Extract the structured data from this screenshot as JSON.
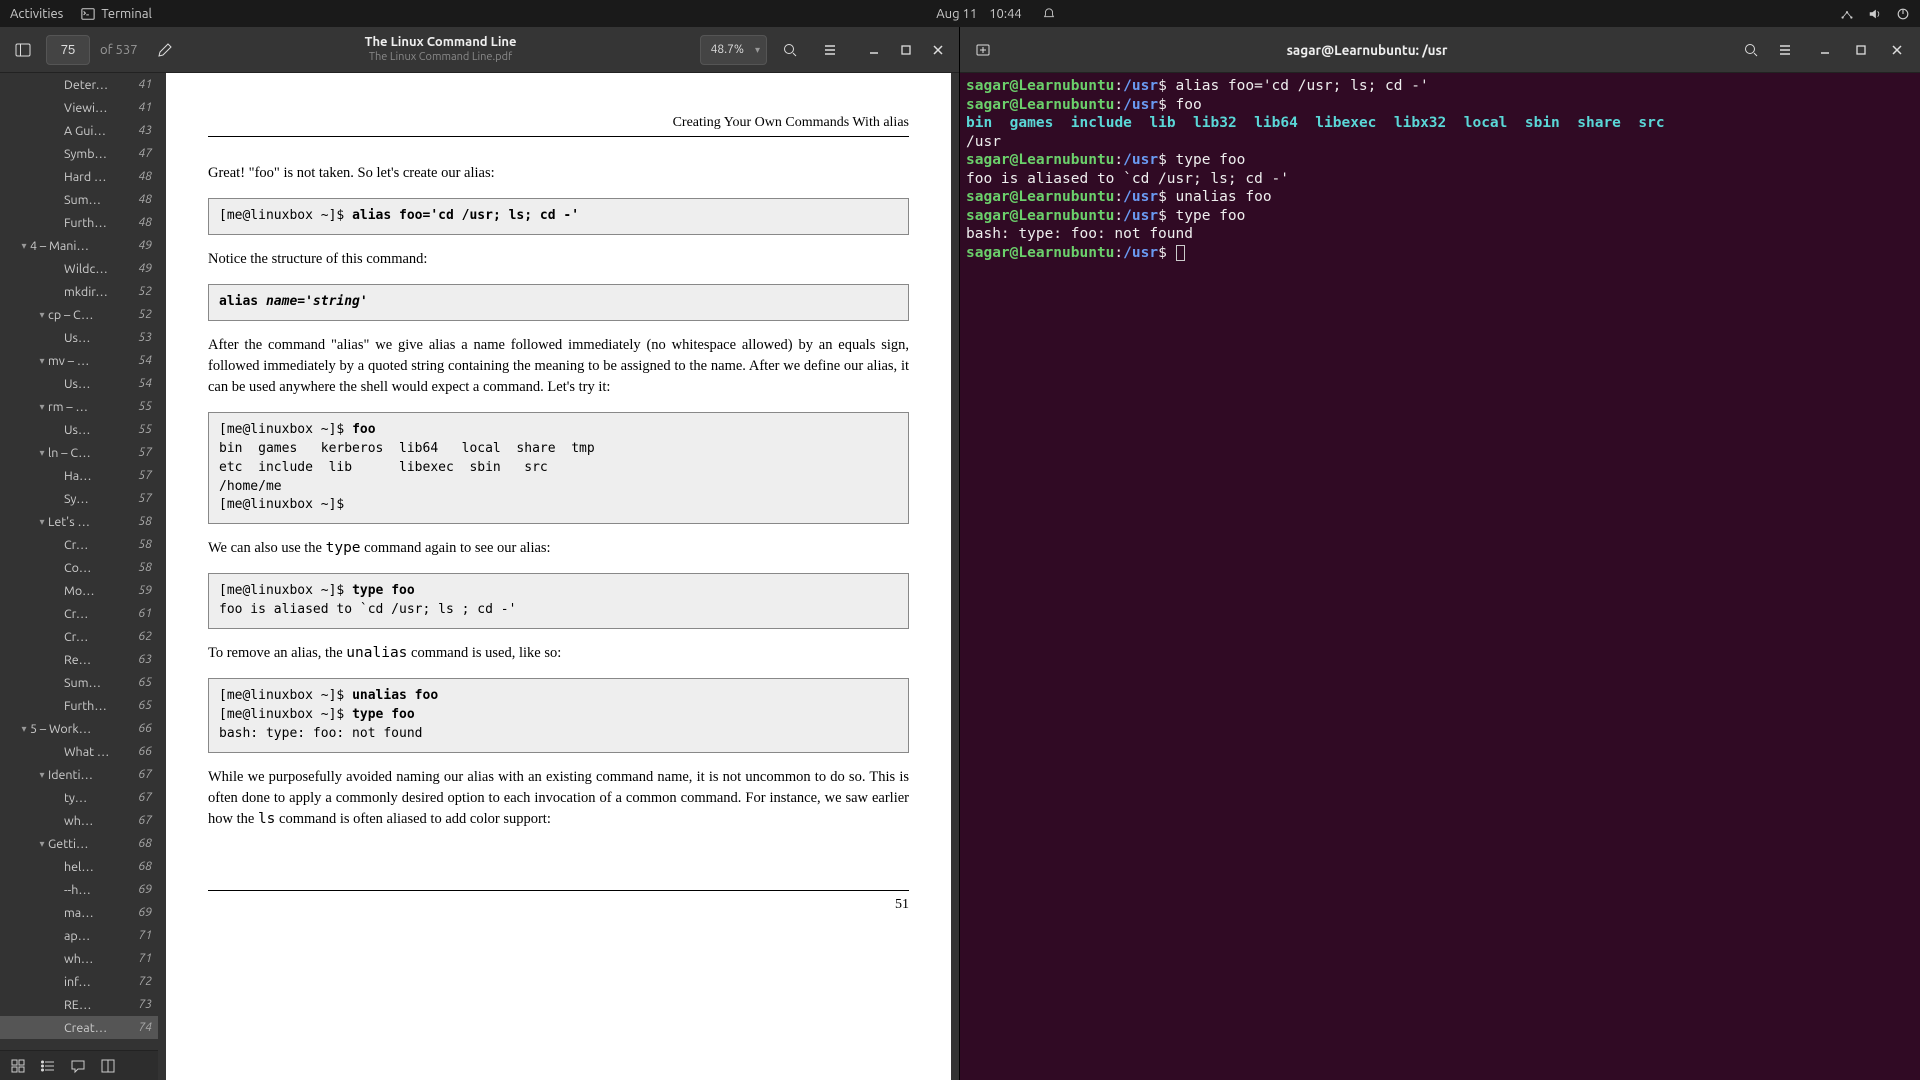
{
  "topbar": {
    "activities": "Activities",
    "app": "Terminal",
    "date": "Aug 11",
    "time": "10:44"
  },
  "pdf": {
    "page_input": "75",
    "page_of": "of 537",
    "title": "The Linux Command Line",
    "subtitle": "The Linux Command Line.pdf",
    "zoom": "48.7%",
    "chapter_header": "Creating Your Own Commands With alias",
    "para1": "Great! \"foo\" is not taken. So let's create our alias:",
    "code1_prompt": "[me@linuxbox ~]$ ",
    "code1_cmd": "alias foo='cd /usr; ls; cd -'",
    "para2": "Notice the structure of this command:",
    "code2_a": "alias ",
    "code2_b": "name='string'",
    "para3": "After the command \"alias\" we give alias a name followed immediately (no whitespace allowed) by an equals sign, followed immediately by a quoted string containing the meaning to be assigned to the name. After we define our alias, it can be used anywhere the shell would expect a command. Let's try it:",
    "code3_prompt": "[me@linuxbox ~]$ ",
    "code3_cmd": "foo",
    "code3_out": "bin  games   kerberos  lib64   local  share  tmp\netc  include  lib      libexec  sbin   src\n/home/me\n[me@linuxbox ~]$",
    "para4a": "We can also use the ",
    "para4_mono": "type",
    "para4b": " command again to see our alias:",
    "code4_prompt": "[me@linuxbox ~]$ ",
    "code4_cmd": "type foo",
    "code4_out": "foo is aliased to `cd /usr; ls ; cd -'",
    "para5a": "To remove an alias, the ",
    "para5_mono": "unalias",
    "para5b": " command is used, like so:",
    "code5_prompt1": "[me@linuxbox ~]$ ",
    "code5_cmd1": "unalias foo",
    "code5_prompt2": "[me@linuxbox ~]$ ",
    "code5_cmd2": "type foo",
    "code5_out": "bash: type: foo: not found",
    "para6a": "While we purposefully avoided naming our alias with an existing command name, it is not uncommon to do so. This is often done to apply a commonly desired option to each invocation of a common command. For instance, we saw earlier how the ",
    "para6_mono": "ls",
    "para6b": " command is often aliased to add color support:",
    "page_number": "51"
  },
  "outline": [
    {
      "indent": 3,
      "chev": "",
      "label": "Deter…",
      "page": "41",
      "sel": false
    },
    {
      "indent": 3,
      "chev": "",
      "label": "Viewi…",
      "page": "41",
      "sel": false
    },
    {
      "indent": 3,
      "chev": "",
      "label": "A Gui…",
      "page": "43",
      "sel": false
    },
    {
      "indent": 3,
      "chev": "",
      "label": "Symb…",
      "page": "47",
      "sel": false
    },
    {
      "indent": 3,
      "chev": "",
      "label": "Hard …",
      "page": "48",
      "sel": false
    },
    {
      "indent": 3,
      "chev": "",
      "label": "Sum…",
      "page": "48",
      "sel": false
    },
    {
      "indent": 3,
      "chev": "",
      "label": "Furth…",
      "page": "48",
      "sel": false
    },
    {
      "indent": 1,
      "chev": "▾",
      "label": "4 – Mani…",
      "page": "49",
      "sel": false
    },
    {
      "indent": 3,
      "chev": "",
      "label": "Wildc…",
      "page": "49",
      "sel": false
    },
    {
      "indent": 3,
      "chev": "",
      "label": "mkdir…",
      "page": "52",
      "sel": false
    },
    {
      "indent": 2,
      "chev": "▾",
      "label": "cp – C…",
      "page": "52",
      "sel": false
    },
    {
      "indent": 3,
      "chev": "",
      "label": "Us…",
      "page": "53",
      "sel": false
    },
    {
      "indent": 2,
      "chev": "▾",
      "label": "mv – …",
      "page": "54",
      "sel": false
    },
    {
      "indent": 3,
      "chev": "",
      "label": "Us…",
      "page": "54",
      "sel": false
    },
    {
      "indent": 2,
      "chev": "▾",
      "label": "rm – …",
      "page": "55",
      "sel": false
    },
    {
      "indent": 3,
      "chev": "",
      "label": "Us…",
      "page": "55",
      "sel": false
    },
    {
      "indent": 2,
      "chev": "▾",
      "label": "ln – C…",
      "page": "57",
      "sel": false
    },
    {
      "indent": 3,
      "chev": "",
      "label": "Ha…",
      "page": "57",
      "sel": false
    },
    {
      "indent": 3,
      "chev": "",
      "label": "Sy…",
      "page": "57",
      "sel": false
    },
    {
      "indent": 2,
      "chev": "▾",
      "label": "Let's …",
      "page": "58",
      "sel": false
    },
    {
      "indent": 3,
      "chev": "",
      "label": "Cr…",
      "page": "58",
      "sel": false
    },
    {
      "indent": 3,
      "chev": "",
      "label": "Co…",
      "page": "58",
      "sel": false
    },
    {
      "indent": 3,
      "chev": "",
      "label": "Mo…",
      "page": "59",
      "sel": false
    },
    {
      "indent": 3,
      "chev": "",
      "label": "Cr…",
      "page": "61",
      "sel": false
    },
    {
      "indent": 3,
      "chev": "",
      "label": "Cr…",
      "page": "62",
      "sel": false
    },
    {
      "indent": 3,
      "chev": "",
      "label": "Re…",
      "page": "63",
      "sel": false
    },
    {
      "indent": 3,
      "chev": "",
      "label": "Sum…",
      "page": "65",
      "sel": false
    },
    {
      "indent": 3,
      "chev": "",
      "label": "Furth…",
      "page": "65",
      "sel": false
    },
    {
      "indent": 1,
      "chev": "▾",
      "label": "5 – Work…",
      "page": "66",
      "sel": false
    },
    {
      "indent": 3,
      "chev": "",
      "label": "What …",
      "page": "66",
      "sel": false
    },
    {
      "indent": 2,
      "chev": "▾",
      "label": "Identi…",
      "page": "67",
      "sel": false
    },
    {
      "indent": 3,
      "chev": "",
      "label": "ty…",
      "page": "67",
      "sel": false
    },
    {
      "indent": 3,
      "chev": "",
      "label": "wh…",
      "page": "67",
      "sel": false
    },
    {
      "indent": 2,
      "chev": "▾",
      "label": "Getti…",
      "page": "68",
      "sel": false
    },
    {
      "indent": 3,
      "chev": "",
      "label": "hel…",
      "page": "68",
      "sel": false
    },
    {
      "indent": 3,
      "chev": "",
      "label": "--h…",
      "page": "69",
      "sel": false
    },
    {
      "indent": 3,
      "chev": "",
      "label": "ma…",
      "page": "69",
      "sel": false
    },
    {
      "indent": 3,
      "chev": "",
      "label": "ap…",
      "page": "71",
      "sel": false
    },
    {
      "indent": 3,
      "chev": "",
      "label": "wh…",
      "page": "71",
      "sel": false
    },
    {
      "indent": 3,
      "chev": "",
      "label": "inf…",
      "page": "72",
      "sel": false
    },
    {
      "indent": 3,
      "chev": "",
      "label": "RE…",
      "page": "73",
      "sel": false
    },
    {
      "indent": 3,
      "chev": "",
      "label": "Creat…",
      "page": "74",
      "sel": true
    }
  ],
  "terminal": {
    "title": "sagar@Learnubuntu: /usr",
    "user": "sagar@Learnubuntu",
    "path": "/usr",
    "cmd1": "alias foo='cd /usr; ls; cd -'",
    "cmd2": "foo",
    "ls_items": [
      "bin",
      "games",
      "include",
      "lib",
      "lib32",
      "lib64",
      "libexec",
      "libx32",
      "local",
      "sbin",
      "share",
      "src"
    ],
    "pwd_out": "/usr",
    "cmd3": "type foo",
    "out3": "foo is aliased to `cd /usr; ls; cd -'",
    "cmd4": "unalias foo",
    "cmd5": "type foo",
    "out5": "bash: type: foo: not found"
  }
}
